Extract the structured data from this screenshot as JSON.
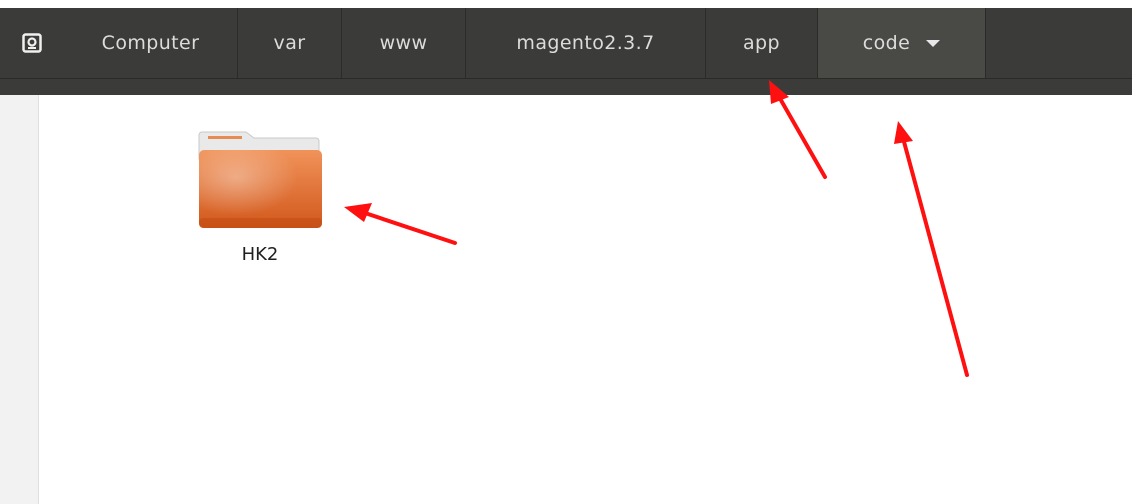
{
  "breadcrumb": {
    "items": [
      "Computer",
      "var",
      "www",
      "magento2.3.7",
      "app",
      "code"
    ],
    "active_index": 5
  },
  "files": [
    {
      "name": "HK2",
      "icon": "folder-icon"
    }
  ],
  "colors": {
    "toolbar": "#3b3b39",
    "folder": "#e0733b",
    "annotation_arrow": "#ff0000"
  }
}
